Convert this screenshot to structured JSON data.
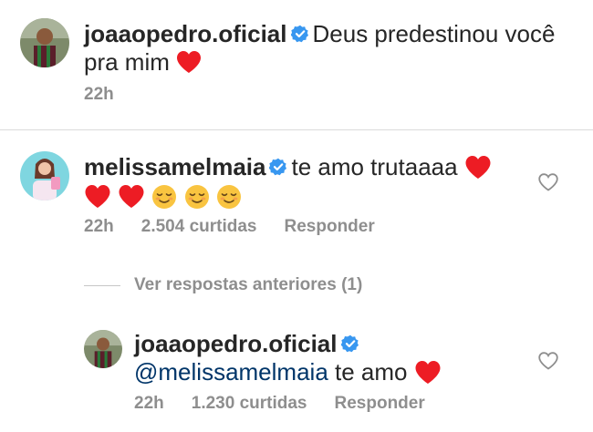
{
  "caption": {
    "username": "joaaopedro.oficial",
    "text": "Deus predestinou você pra mim",
    "time": "22h",
    "icons": [
      "verified-badge-icon",
      "red-heart-icon"
    ]
  },
  "comment": {
    "username": "melissamelmaia",
    "text": "te amo trutaaaa",
    "emojis": [
      "red-heart",
      "red-heart",
      "red-heart",
      "relieved-face",
      "relieved-face",
      "relieved-face"
    ],
    "time": "22h",
    "likes": "2.504 curtidas",
    "reply_label": "Responder"
  },
  "view_replies": {
    "label": "Ver respostas anteriores (1)"
  },
  "reply": {
    "username": "joaaopedro.oficial",
    "mention": "@melissamelmaia",
    "text": "te amo",
    "time": "22h",
    "likes": "1.230 curtidas",
    "reply_label": "Responder"
  },
  "colors": {
    "text": "#262626",
    "secondary": "#8e8e8e",
    "mention": "#003569",
    "verified": "#3897f0",
    "heart": "#ed1c24"
  }
}
